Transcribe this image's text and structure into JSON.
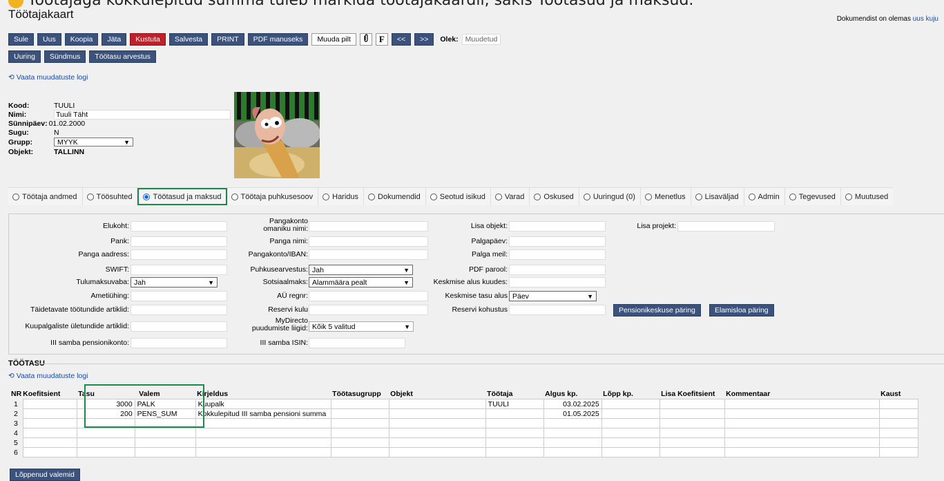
{
  "top_text": "Töötajaga kokkulepitud summa tuleb märkida töötajakaardil, sakis Töötasud ja maksud.",
  "title": "Töötajakaart",
  "doc_note": {
    "text": "Dokumendist on olemas",
    "link": "uus kuju"
  },
  "toolbar1": [
    "Sule",
    "Uus",
    "Koopia",
    "Jäta",
    "Kustuta",
    "Salvesta",
    "PRINT",
    "PDF manuseks"
  ],
  "muuda_pilt": "Muuda pilt",
  "f_label": "F",
  "nav_prev": "<<",
  "nav_next": ">>",
  "olek_label": "Olek:",
  "olek_value": "Muudetud",
  "toolbar2": [
    "Uuring",
    "Sündmus",
    "Töötasu arvestus"
  ],
  "log_link": "Vaata muudatuste logi",
  "employee": {
    "kood_label": "Kood:",
    "kood": "TUULI",
    "nimi_label": "Nimi:",
    "nimi": "Tuuli Täht",
    "synd_label": "Sünnipäev:",
    "synd": "01.02.2000",
    "sugu_label": "Sugu:",
    "sugu": "N",
    "grupp_label": "Grupp:",
    "grupp": "MYYK",
    "objekt_label": "Objekt:",
    "objekt": "TALLINN"
  },
  "tabs": [
    "Töötaja andmed",
    "Töösuhted",
    "Töötasud ja maksud",
    "Töötaja puhkusesoov",
    "Haridus",
    "Dokumendid",
    "Seotud isikud",
    "Varad",
    "Oskused",
    "Uuringud (0)",
    "Menetlus",
    "Lisaväljad",
    "Admin",
    "Tegevused",
    "Muutused"
  ],
  "fields": {
    "elukoht": "Elukoht:",
    "pank": "Pank:",
    "panga_aadress": "Panga aadress:",
    "swift": "SWIFT:",
    "tulumaksuvaba": "Tulumaksuvaba:",
    "tulumaksuvaba_val": "Jah",
    "ametiyhing": "Ametiühing:",
    "taidetavate": "Täidetavate töötundide artiklid:",
    "kuupalgaliste": "Kuupalgaliste ületundide artiklid:",
    "iii_konto": "III samba pensionikonto:",
    "pangakonto_omanik_1": "Pangakonto",
    "pangakonto_omanik_2": "omaniku nimi:",
    "panga_nimi": "Panga nimi:",
    "iban": "Pangakonto/IBAN:",
    "puhkusearvestus": "Puhkusearvestus:",
    "puhkusearvestus_val": "Jah",
    "sotsiaalmaks": "Sotsiaalmaks:",
    "sotsiaalmaks_val": "Alammäära pealt",
    "au_regnr": "AÜ regnr:",
    "reservi_kulu": "Reservi kulu",
    "mydirecto_1": "MyDirecto",
    "mydirecto_2": "puudumiste liigid:",
    "mydirecto_val": "Kõik 5 valitud",
    "iii_isin": "III samba ISIN:",
    "lisa_objekt": "Lisa objekt:",
    "palgapaev": "Palgapäev:",
    "palga_meil": "Palga meil:",
    "pdf_parool": "PDF parool:",
    "keskmise_kuudes": "Keskmise alus kuudes:",
    "keskmise_tasu": "Keskmise tasu alus",
    "keskmise_tasu_val": "Päev",
    "reservi_kohustus": "Reservi kohustus",
    "lisa_projekt": "Lisa projekt:",
    "btn_pension": "Pensionikeskuse päring",
    "btn_elamisloa": "Elamisloa päring"
  },
  "section_title": "TÖÖTASU",
  "table": {
    "headers": [
      "NR",
      "Koefitsient",
      "Tasu",
      "Valem",
      "Kirjeldus",
      "Töötasugrupp",
      "Objekt",
      "Töötaja",
      "Algus kp.",
      "Lõpp kp.",
      "Lisa Koefitsient",
      "Kommentaar",
      "Kaust"
    ],
    "rows": [
      {
        "nr": "1",
        "tasu": "3000",
        "valem": "PALK",
        "kirjeldus": "Kuupalk",
        "tootaja": "TUULI",
        "algus": "03.02.2025"
      },
      {
        "nr": "2",
        "tasu": "200",
        "valem": "PENS_SUM",
        "kirjeldus": "Kokkulepitud III samba pensioni summa",
        "tootaja": "",
        "algus": "01.05.2025"
      },
      {
        "nr": "3",
        "tasu": "",
        "valem": "",
        "kirjeldus": "",
        "tootaja": "",
        "algus": ""
      },
      {
        "nr": "4",
        "tasu": "",
        "valem": "",
        "kirjeldus": "",
        "tootaja": "",
        "algus": ""
      },
      {
        "nr": "5",
        "tasu": "",
        "valem": "",
        "kirjeldus": "",
        "tootaja": "",
        "algus": ""
      },
      {
        "nr": "6",
        "tasu": "",
        "valem": "",
        "kirjeldus": "",
        "tootaja": "",
        "algus": ""
      }
    ]
  },
  "bottom_button": "Lõppenud valemid"
}
